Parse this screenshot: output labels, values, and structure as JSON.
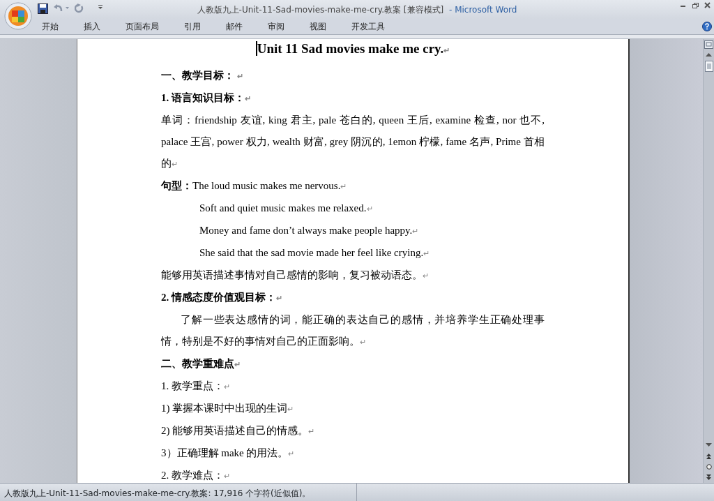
{
  "window": {
    "title": "人教版九上-Unit-11-Sad-movies-make-me-cry.教案 [兼容模式]",
    "app": "- Microsoft Word"
  },
  "ribbon_tabs": [
    "开始",
    "插入",
    "页面布局",
    "引用",
    "邮件",
    "审阅",
    "视图",
    "开发工具"
  ],
  "document": {
    "paragraphs": [
      {
        "kind": "title",
        "text": "Unit 11 Sad movies make me cry.",
        "mark": "↵"
      },
      {
        "kind": "heading",
        "text": "一、教学目标： ",
        "mark": "↵"
      },
      {
        "kind": "heading",
        "text": "1. 语言知识目标：",
        "mark": "↵"
      },
      {
        "kind": "body",
        "text": "单词：friendship 友谊, king 君主, pale 苍白的, queen 王后, examine 检查, nor 也不, palace 王宫, power 权力, wealth 财富, grey 阴沉的, 1emon 柠檬, fame 名声, Prime 首相的",
        "mark": "↵"
      },
      {
        "kind": "body",
        "text": "**句型：**The loud music makes me nervous.",
        "mark": "↵"
      },
      {
        "kind": "indented",
        "text": "Soft and quiet music makes me relaxed.",
        "mark": "↵"
      },
      {
        "kind": "indented",
        "text": "Money and fame don’t always make people happy.",
        "mark": "↵"
      },
      {
        "kind": "indented",
        "text": "She said that the sad movie made her feel like crying.",
        "mark": "↵"
      },
      {
        "kind": "body",
        "text": "能够用英语描述事情对自己感情的影响，复习被动语态。",
        "mark": "↵"
      },
      {
        "kind": "heading",
        "text": "2. 情感态度价值观目标：",
        "mark": "↵"
      },
      {
        "kind": "first-indent",
        "text": "了解一些表达感情的词，能正确的表达自己的感情，并培养学生正确处理事情，特别是不好的事情对自己的正面影响。",
        "mark": "↵"
      },
      {
        "kind": "heading",
        "text": "二、教学重难点",
        "mark": "↵"
      },
      {
        "kind": "body",
        "text": "1. 教学重点：",
        "mark": "↵"
      },
      {
        "kind": "body",
        "text": "1) 掌握本课时中出现的生词",
        "mark": "↵"
      },
      {
        "kind": "body",
        "text": "2) 能够用英语描述自己的情感。",
        "mark": "↵"
      },
      {
        "kind": "body",
        "text": "3）正确理解 make 的用法。",
        "mark": "↵"
      },
      {
        "kind": "body",
        "text": "2. 教学难点：",
        "mark": "↵"
      }
    ]
  },
  "status_bar": {
    "text": "人教版九上-Unit-11-Sad-movies-make-me-cry.教案: 17,916 个字符(近似值)。"
  }
}
